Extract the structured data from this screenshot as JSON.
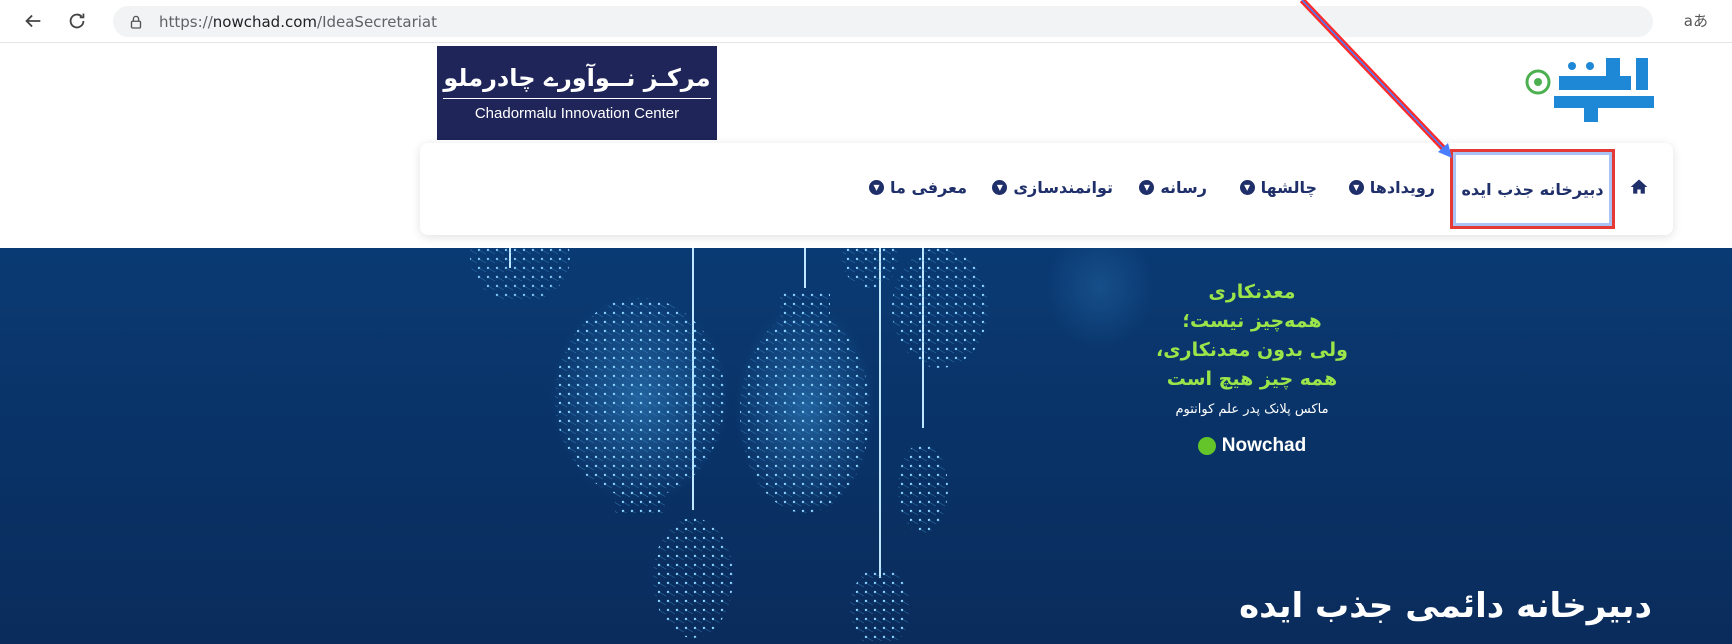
{
  "browser": {
    "url_prefix": "https://",
    "url_domain": "nowchad.com",
    "url_path": "/IdeaSecretariat",
    "reader_label": "aあ"
  },
  "header": {
    "center_logo_fa": "مرکـز نــوآورے چادرملو",
    "center_logo_en": "Chadormalu Innovation Center",
    "brand_logo_alt": "نوچاد"
  },
  "nav": {
    "active_item": "دبیرخانه جذب ایده",
    "items": [
      "رویدادها",
      "چالشها",
      "رسانه",
      "توانمندسازی",
      "معرفی ما"
    ]
  },
  "hero": {
    "quote_lines": [
      "معدنکاری",
      "همه‌چیز نیست؛",
      "ولی بدون معدنکاری،",
      "همه چیز هیچ است"
    ],
    "quote_author": "ماکس پلانک پدر علم کوانتوم",
    "quote_brand": "Nowchad",
    "title": "دبیرخانه دائمی جذب ایده"
  },
  "colors": {
    "navy": "#1f2f6a",
    "accent_green": "#9be44a",
    "highlight_red": "#e53935",
    "hero_bg": "#093368"
  }
}
